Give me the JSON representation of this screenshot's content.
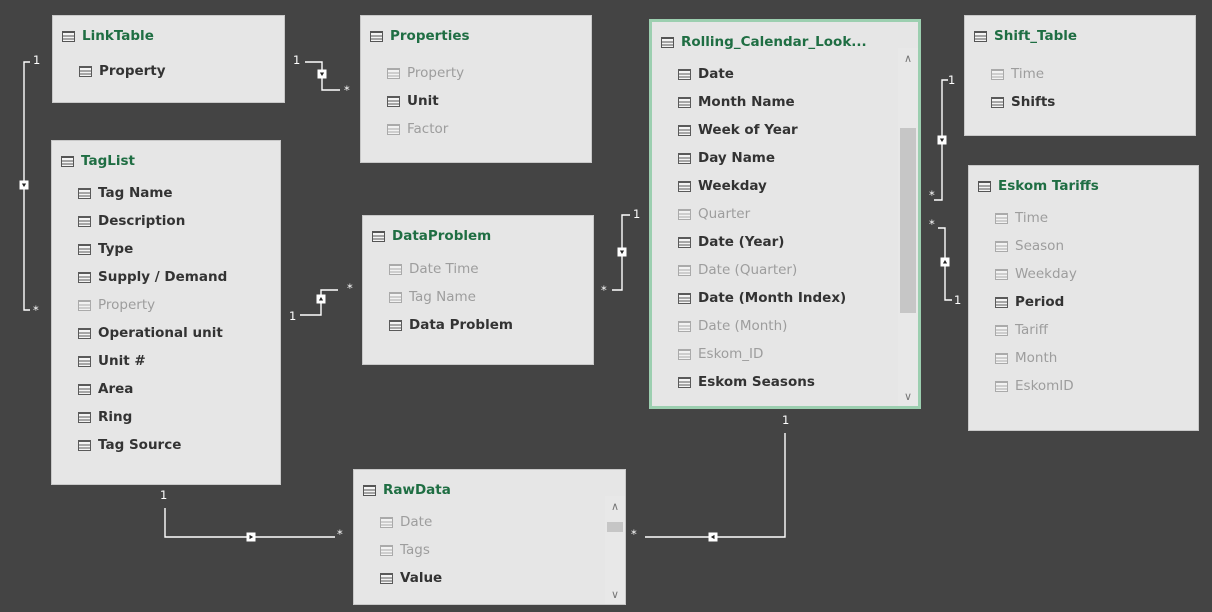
{
  "tables": [
    {
      "id": "linktable",
      "title": "LinkTable",
      "fields": [
        {
          "name": "Property",
          "visible": true
        }
      ]
    },
    {
      "id": "properties",
      "title": "Properties",
      "fields": [
        {
          "name": "Property",
          "visible": false
        },
        {
          "name": "Unit",
          "visible": true
        },
        {
          "name": "Factor",
          "visible": false
        }
      ]
    },
    {
      "id": "rolling_calendar",
      "title": "Rolling_Calendar_Look...",
      "selected": true,
      "scrollbar": true,
      "fields": [
        {
          "name": "Date",
          "visible": true
        },
        {
          "name": "Month Name",
          "visible": true
        },
        {
          "name": "Week of Year",
          "visible": true
        },
        {
          "name": "Day Name",
          "visible": true
        },
        {
          "name": "Weekday",
          "visible": true
        },
        {
          "name": "Quarter",
          "visible": false
        },
        {
          "name": "Date (Year)",
          "visible": true
        },
        {
          "name": "Date (Quarter)",
          "visible": false
        },
        {
          "name": "Date (Month Index)",
          "visible": true
        },
        {
          "name": "Date (Month)",
          "visible": false
        },
        {
          "name": "Eskom_ID",
          "visible": false
        },
        {
          "name": "Eskom Seasons",
          "visible": true
        }
      ]
    },
    {
      "id": "shift_table",
      "title": "Shift_Table",
      "fields": [
        {
          "name": "Time",
          "visible": false
        },
        {
          "name": "Shifts",
          "visible": true
        }
      ]
    },
    {
      "id": "taglist",
      "title": "TagList",
      "fields": [
        {
          "name": "Tag Name",
          "visible": true
        },
        {
          "name": "Description",
          "visible": true
        },
        {
          "name": "Type",
          "visible": true
        },
        {
          "name": "Supply / Demand",
          "visible": true
        },
        {
          "name": "Property",
          "visible": false
        },
        {
          "name": "Operational unit",
          "visible": true
        },
        {
          "name": "Unit #",
          "visible": true
        },
        {
          "name": "Area",
          "visible": true
        },
        {
          "name": "Ring",
          "visible": true
        },
        {
          "name": "Tag Source",
          "visible": true
        }
      ]
    },
    {
      "id": "dataproblem",
      "title": "DataProblem",
      "fields": [
        {
          "name": "Date Time",
          "visible": false
        },
        {
          "name": "Tag Name",
          "visible": false
        },
        {
          "name": "Data Problem",
          "visible": true
        }
      ]
    },
    {
      "id": "eskom_tariffs",
      "title": "Eskom Tariffs",
      "fields": [
        {
          "name": "Time",
          "visible": false
        },
        {
          "name": "Season",
          "visible": false
        },
        {
          "name": "Weekday",
          "visible": false
        },
        {
          "name": "Period",
          "visible": true
        },
        {
          "name": "Tariff",
          "visible": false
        },
        {
          "name": "Month",
          "visible": false
        },
        {
          "name": "EskomID",
          "visible": false
        }
      ]
    },
    {
      "id": "rawdata",
      "title": "RawData",
      "scrollbar": true,
      "fields": [
        {
          "name": "Date",
          "visible": false
        },
        {
          "name": "Tags",
          "visible": false
        },
        {
          "name": "Value",
          "visible": true
        }
      ]
    }
  ],
  "relationships": [
    {
      "id": "taglist-linktable",
      "one_label": "1",
      "many_label": "*"
    },
    {
      "id": "linktable-properties",
      "one_label": "1",
      "many_label": "*"
    },
    {
      "id": "taglist-dataproblem",
      "one_label": "1",
      "many_label": "*"
    },
    {
      "id": "calendar-dataproblem",
      "one_label": "1",
      "many_label": "*"
    },
    {
      "id": "shift-calendar",
      "one_label": "1",
      "many_label": "*"
    },
    {
      "id": "eskom-calendar",
      "one_label": "1",
      "many_label": "*"
    },
    {
      "id": "taglist-rawdata",
      "one_label": "1",
      "many_label": "*"
    },
    {
      "id": "calendar-rawdata",
      "one_label": "1",
      "many_label": "*"
    }
  ],
  "colors": {
    "canvas": "#444444",
    "table_bg": "#e6e6e6",
    "table_title": "#1f6e43",
    "selected_border": "#9ccfb0",
    "field_visible": "#333333",
    "field_hidden": "#9d9d9d"
  },
  "icons": {
    "table": "table-icon",
    "field": "column-icon"
  }
}
